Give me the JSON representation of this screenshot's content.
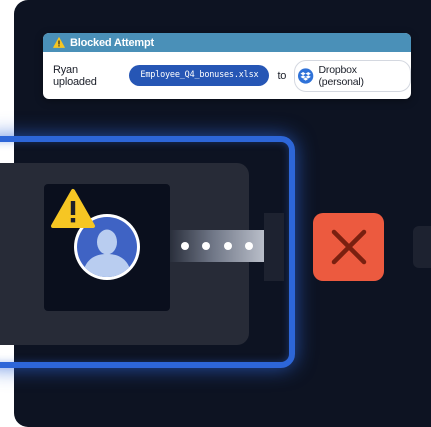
{
  "alert": {
    "title": "Blocked Attempt",
    "user_text": "Ryan uploaded",
    "file_name": "Employee_Q4_bonuses.xlsx",
    "connector_text": "to",
    "destination": "Dropbox (personal)"
  },
  "colors": {
    "header": "#4a90b8",
    "file_pill": "#2656b5",
    "frame": "#2d66d8",
    "block": "#ec5a3f",
    "warning": "#f6c623",
    "panel": "#0d1322"
  },
  "icons": {
    "alert": "warning-triangle",
    "destination": "dropbox-logo",
    "user": "user-avatar",
    "blocked": "close-x"
  }
}
